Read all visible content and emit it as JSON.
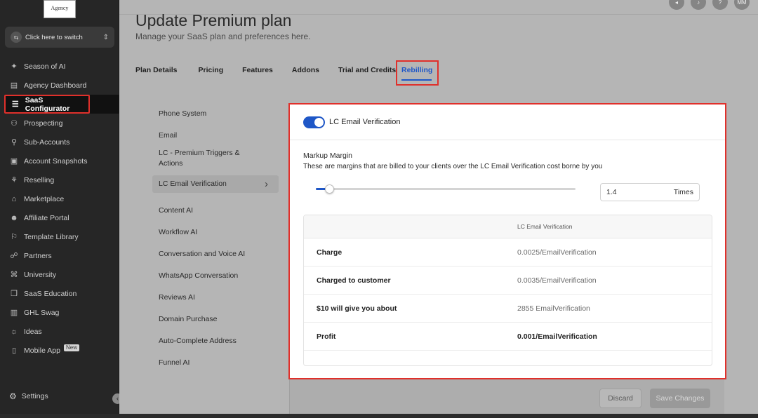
{
  "sidebar": {
    "logo_text": "Agency",
    "switcher_label": "Click here to switch",
    "items": [
      {
        "label": "Season of AI",
        "icon": "sparkle-icon"
      },
      {
        "label": "Agency Dashboard",
        "icon": "dashboard-icon"
      },
      {
        "label": "SaaS Configurator",
        "icon": "configurator-icon",
        "active": true
      },
      {
        "label": "Prospecting",
        "icon": "prospecting-icon"
      },
      {
        "label": "Sub-Accounts",
        "icon": "user-icon"
      },
      {
        "label": "Account Snapshots",
        "icon": "snapshot-icon"
      },
      {
        "label": "Reselling",
        "icon": "reselling-icon"
      },
      {
        "label": "Marketplace",
        "icon": "bag-icon"
      },
      {
        "label": "Affiliate Portal",
        "icon": "affiliate-icon"
      },
      {
        "label": "Template Library",
        "icon": "library-icon"
      },
      {
        "label": "Partners",
        "icon": "handshake-icon"
      },
      {
        "label": "University",
        "icon": "graduation-icon"
      },
      {
        "label": "SaaS Education",
        "icon": "education-icon"
      },
      {
        "label": "GHL Swag",
        "icon": "swag-icon"
      },
      {
        "label": "Ideas",
        "icon": "lightbulb-icon"
      },
      {
        "label": "Mobile App",
        "icon": "mobile-icon",
        "badge": "New"
      }
    ],
    "settings_label": "Settings"
  },
  "header": {
    "avatar_initials": "MM",
    "title": "Update Premium plan",
    "subtitle": "Manage your SaaS plan and preferences here."
  },
  "tabs": [
    {
      "label": "Plan Details"
    },
    {
      "label": "Pricing"
    },
    {
      "label": "Features"
    },
    {
      "label": "Addons"
    },
    {
      "label": "Trial and Credits"
    },
    {
      "label": "Rebilling",
      "active": true
    }
  ],
  "rebilling_menu": [
    "Phone System",
    "Email",
    "LC - Premium Triggers & Actions",
    "LC Email Verification",
    "Content AI",
    "Workflow AI",
    "Conversation and Voice AI",
    "WhatsApp Conversation",
    "Reviews AI",
    "Domain Purchase",
    "Auto-Complete Address",
    "Funnel AI"
  ],
  "panel": {
    "toggle_label": "LC Email Verification",
    "toggle_on": true,
    "markup_title": "Markup Margin",
    "markup_desc": "These are margins that are billed to your clients over the LC Email Verification cost borne by you",
    "slider_fraction": 0.05,
    "multiplier_value": "1.4",
    "multiplier_unit": "Times",
    "table_header": "LC Email Verification",
    "rows": [
      {
        "label": "Charge",
        "value": "0.0025/EmailVerification"
      },
      {
        "label": "Charged to customer",
        "value": "0.0035/EmailVerification"
      },
      {
        "label": "$10 will give you about",
        "value": "2855 EmailVerification"
      },
      {
        "label": "Profit",
        "value": "0.001/EmailVerification"
      }
    ]
  },
  "actions": {
    "discard": "Discard",
    "save": "Save Changes"
  },
  "colors": {
    "accent": "#1f57c7",
    "highlight": "#e0302b"
  }
}
